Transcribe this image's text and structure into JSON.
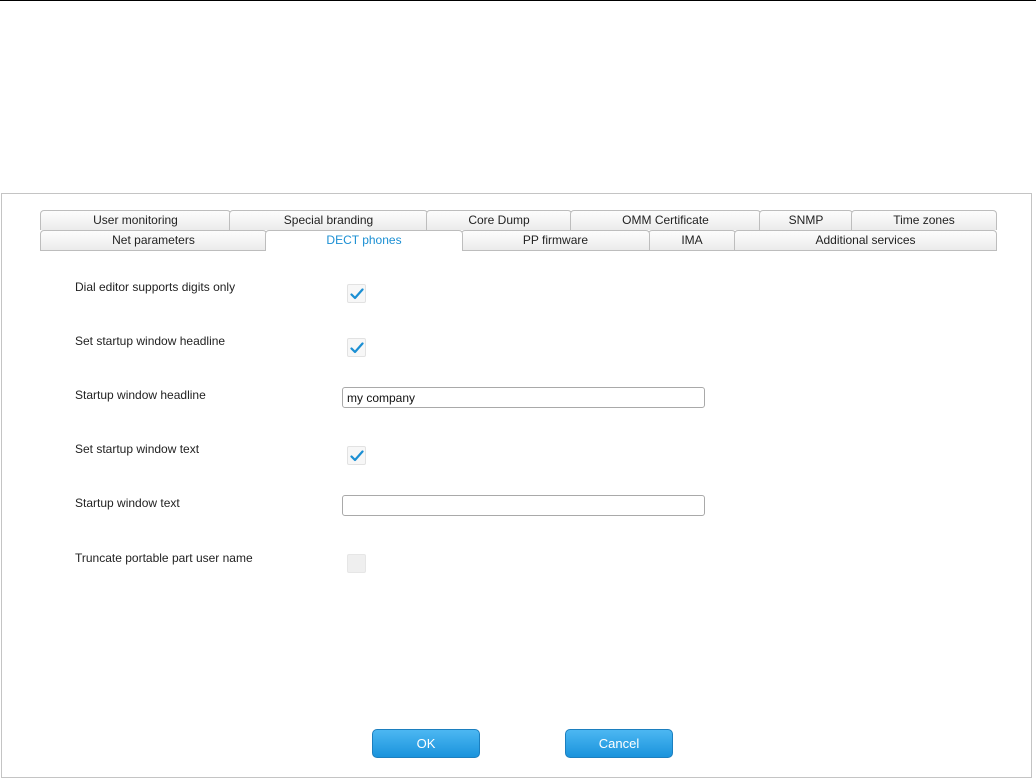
{
  "tabs": {
    "row1": [
      {
        "label": "User monitoring"
      },
      {
        "label": "Special branding"
      },
      {
        "label": "Core Dump"
      },
      {
        "label": "OMM Certificate"
      },
      {
        "label": "SNMP"
      },
      {
        "label": "Time zones"
      }
    ],
    "row2": [
      {
        "label": "Net parameters"
      },
      {
        "label": "DECT phones",
        "active": true
      },
      {
        "label": "PP firmware"
      },
      {
        "label": "IMA"
      },
      {
        "label": "Additional services"
      }
    ]
  },
  "form": {
    "dial_editor_digits_only": {
      "label": "Dial editor supports digits only",
      "checked": true
    },
    "set_startup_headline": {
      "label": "Set startup window headline",
      "checked": true
    },
    "startup_headline": {
      "label": "Startup window headline",
      "value": "my company",
      "placeholder": ""
    },
    "set_startup_text": {
      "label": "Set startup window text",
      "checked": true
    },
    "startup_text": {
      "label": "Startup window text",
      "value": "",
      "placeholder": ""
    },
    "truncate_pp_username": {
      "label": "Truncate portable part user name",
      "checked": false,
      "disabled": true
    }
  },
  "buttons": {
    "ok_label": "OK",
    "cancel_label": "Cancel"
  },
  "colors": {
    "accent": "#1b8fd3",
    "button_blue": "#2aa3e6",
    "check_blue": "#1b8fd3"
  }
}
